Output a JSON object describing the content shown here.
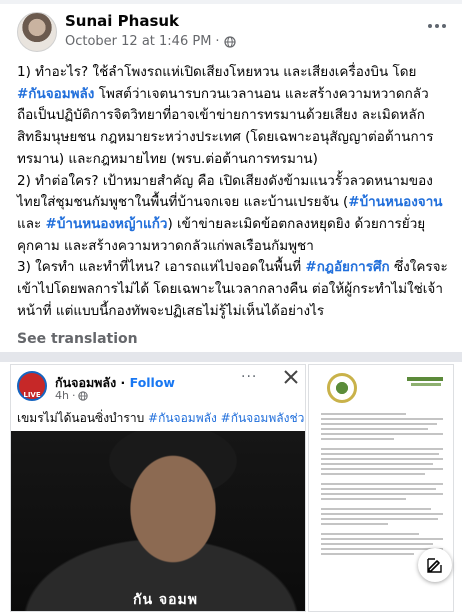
{
  "post": {
    "author": "Sunai Phasuk",
    "timestamp": "October 12 at 1:46 PM",
    "separator": "·",
    "paragraphs": [
      {
        "segments": [
          {
            "text": "1) ทำอะไร? ใช้ลำโพงรถแห่เปิดเสียงโหยหวน และเสียงเครื่องบิน โดย "
          },
          {
            "text": "#กันจอมพลัง",
            "tag": true
          },
          {
            "text": " โพสต์ว่าเจตนารบกวนเวลานอน และสร้างความหวาดกลัว ถือเป็นปฏิบัติการจิตวิทยาที่อาจเข้าข่ายการทรมานด้วยเสียง ละเมิดหลักสิทธิมนุษยชน กฎหมายระหว่างประเทศ (โดยเฉพาะอนุสัญญาต่อต้านการทรมาน) และกฎหมายไทย (พรบ.ต่อต้านการทรมาน)"
          }
        ]
      },
      {
        "segments": [
          {
            "text": "2) ทำต่อใคร? เป้าหมายสำคัญ คือ เปิดเสียงดังข้ามแนวรั้วลวดหนามของไทยใส่ชุมชนกัมพูชาในพื้นที่บ้านจกเจย และบ้านเปรยจัน ("
          },
          {
            "text": "#บ้านหนองจาน",
            "tag": true
          },
          {
            "text": " และ "
          },
          {
            "text": "#บ้านหนองหญ้าแก้ว",
            "tag": true
          },
          {
            "text": ") เข้าข่ายละเมิดข้อตกลงหยุดยิง ด้วยการยั่วยุ คุกคาม และสร้างความหวาดกลัวแก่พลเรือนกัมพูชา"
          }
        ]
      },
      {
        "segments": [
          {
            "text": "3) ใครทำ และทำที่ไหน? เอารถแห่ไปจอดในพื้นที่ "
          },
          {
            "text": "#กฎอัยการศึก",
            "tag": true
          },
          {
            "text": " ซึ่งใครจะเข้าไปโดยพลการไม่ได้ โดยเฉพาะในเวลากลางคืน ต่อให้ผู้กระทำไม่ใช่เจ้าหน้าที่ แต่แบบนี้กองทัพจะปฏิเสธไม่รู้ไม่เห็นได้อย่างไร"
          }
        ]
      }
    ],
    "see_translation": "See translation"
  },
  "shared_post": {
    "page_name": "กันจอมพลัง",
    "follow_label": "Follow",
    "dot": " · ",
    "time": "4h",
    "separator": "·",
    "caption_text": "เขมรไม่ได้นอนซิ่งบำราบ ",
    "caption_tag1": "#กันจอมพลัง",
    "caption_tag2": "#กันจอมพลังช่วยสู้",
    "avatar_text": "LIVE",
    "vest_text": "กัน จอมพ"
  },
  "icons": {
    "more": "more-horizontal-icon",
    "globe": "globe-icon",
    "close": "close-icon",
    "compose": "compose-icon"
  },
  "colors": {
    "hashtag": "#216fdb",
    "follow": "#1877f2",
    "muted": "#65676b"
  }
}
